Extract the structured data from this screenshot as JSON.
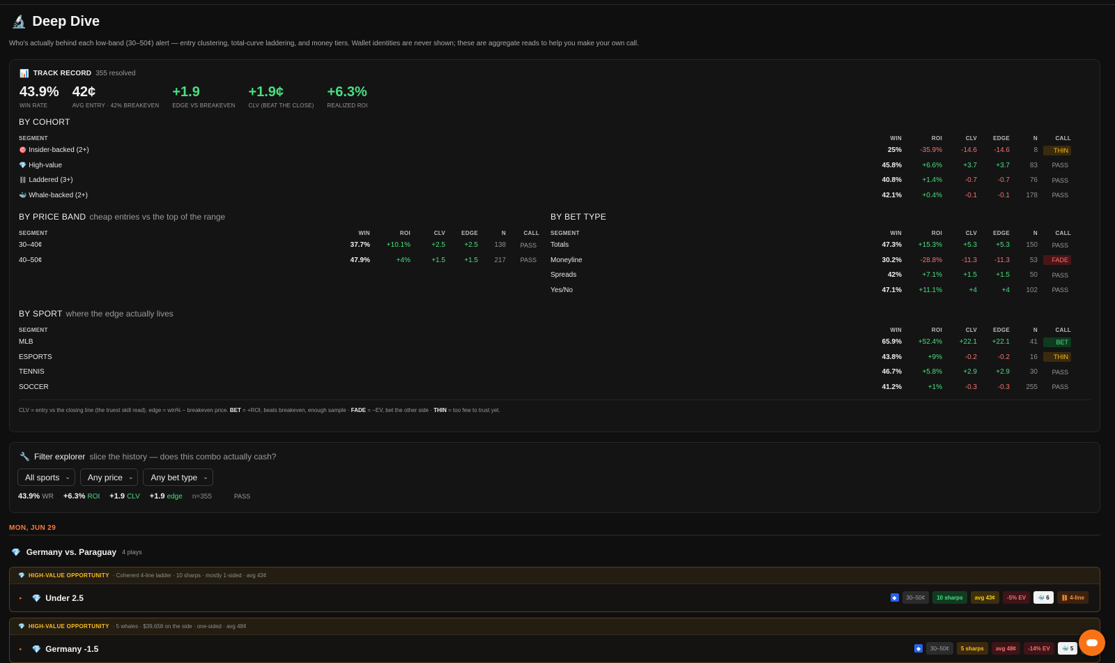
{
  "header": {
    "icon": "🔬",
    "title": "Deep Dive",
    "subtitle": "Who's actually behind each low-band (30–50¢) alert — entry clustering, total-curve laddering, and money tiers. Wallet identities are never shown; these are aggregate reads to help you make your own call."
  },
  "track": {
    "icon": "📊",
    "title": "TRACK RECORD",
    "resolved": "355 resolved",
    "stats": [
      {
        "value": "43.9%",
        "label": "WIN RATE",
        "green": false
      },
      {
        "value": "42¢",
        "label": "AVG ENTRY · 42% BREAKEVEN",
        "green": false
      },
      {
        "value": "+1.9",
        "label": "EDGE VS BREAKEVEN",
        "green": true
      },
      {
        "value": "+1.9¢",
        "label": "CLV (BEAT THE CLOSE)",
        "green": true
      },
      {
        "value": "+6.3%",
        "label": "REALIZED ROI",
        "green": true
      }
    ]
  },
  "cols": {
    "segment": "SEGMENT",
    "win": "WIN",
    "roi": "ROI",
    "clv": "CLV",
    "edge": "EDGE",
    "n": "N",
    "call": "CALL"
  },
  "cohort": {
    "title": "BY COHORT",
    "rows": [
      {
        "icon": "🎯",
        "name": "Insider-backed (2+)",
        "win": "25%",
        "roi": "-35.9%",
        "clv": "-14.6",
        "edge": "-14.6",
        "n": "8",
        "call": "THIN",
        "cls": "thin"
      },
      {
        "icon": "💎",
        "name": "High-value",
        "win": "45.8%",
        "roi": "+6.6%",
        "clv": "+3.7",
        "edge": "+3.7",
        "n": "83",
        "call": "PASS",
        "cls": ""
      },
      {
        "icon": "⛓",
        "name": "Laddered (3+)",
        "win": "40.8%",
        "roi": "+1.4%",
        "clv": "-0.7",
        "edge": "-0.7",
        "n": "76",
        "call": "PASS",
        "cls": ""
      },
      {
        "icon": "🐳",
        "name": "Whale-backed (2+)",
        "win": "42.1%",
        "roi": "+0.4%",
        "clv": "-0.1",
        "edge": "-0.1",
        "n": "178",
        "call": "PASS",
        "cls": ""
      }
    ]
  },
  "price_band": {
    "title": "BY PRICE BAND",
    "sub": "cheap entries vs the top of the range",
    "rows": [
      {
        "name": "30–40¢",
        "win": "37.7%",
        "roi": "+10.1%",
        "clv": "+2.5",
        "edge": "+2.5",
        "n": "138",
        "call": "PASS",
        "cls": ""
      },
      {
        "name": "40–50¢",
        "win": "47.9%",
        "roi": "+4%",
        "clv": "+1.5",
        "edge": "+1.5",
        "n": "217",
        "call": "PASS",
        "cls": ""
      }
    ]
  },
  "bet_type": {
    "title": "BY BET TYPE",
    "rows": [
      {
        "name": "Totals",
        "win": "47.3%",
        "roi": "+15.3%",
        "clv": "+5.3",
        "edge": "+5.3",
        "n": "150",
        "call": "PASS",
        "cls": ""
      },
      {
        "name": "Moneyline",
        "win": "30.2%",
        "roi": "-28.8%",
        "clv": "-11.3",
        "edge": "-11.3",
        "n": "53",
        "call": "FADE",
        "cls": "fade"
      },
      {
        "name": "Spreads",
        "win": "42%",
        "roi": "+7.1%",
        "clv": "+1.5",
        "edge": "+1.5",
        "n": "50",
        "call": "PASS",
        "cls": ""
      },
      {
        "name": "Yes/No",
        "win": "47.1%",
        "roi": "+11.1%",
        "clv": "+4",
        "edge": "+4",
        "n": "102",
        "call": "PASS",
        "cls": ""
      }
    ]
  },
  "sport": {
    "title": "BY SPORT",
    "sub": "where the edge actually lives",
    "rows": [
      {
        "name": "MLB",
        "win": "65.9%",
        "roi": "+52.4%",
        "clv": "+22.1",
        "edge": "+22.1",
        "n": "41",
        "call": "BET",
        "cls": "bet"
      },
      {
        "name": "ESPORTS",
        "win": "43.8%",
        "roi": "+9%",
        "clv": "-0.2",
        "edge": "-0.2",
        "n": "16",
        "call": "THIN",
        "cls": "thin"
      },
      {
        "name": "TENNIS",
        "win": "46.7%",
        "roi": "+5.8%",
        "clv": "+2.9",
        "edge": "+2.9",
        "n": "30",
        "call": "PASS",
        "cls": ""
      },
      {
        "name": "SOCCER",
        "win": "41.2%",
        "roi": "+1%",
        "clv": "-0.3",
        "edge": "-0.3",
        "n": "255",
        "call": "PASS",
        "cls": ""
      }
    ]
  },
  "legend": {
    "p1": "CLV = entry vs the closing line (the truest skill read). edge = win% − breakeven price. ",
    "bet": "BET",
    "p2": " = +ROI, beats breakeven, enough sample · ",
    "fade": "FADE",
    "p3": " = −EV, bet the other side · ",
    "thin": "THIN",
    "p4": " = too few to trust yet."
  },
  "filter": {
    "icon": "🔧",
    "title": "Filter explorer",
    "sub": "slice the history — does this combo actually cash?",
    "selects": [
      "All sports",
      "Any price",
      "Any bet type"
    ],
    "wr": "43.9%",
    "wr_label": "WR",
    "roi": "+6.3%",
    "roi_label": "ROI",
    "clv": "+1.9",
    "clv_label": "CLV",
    "edge": "+1.9",
    "edge_label": "edge",
    "n": "n=355",
    "call": "PASS"
  },
  "feed": {
    "date": "MON, JUN 29",
    "match": {
      "name": "Germany vs. Paraguay",
      "plays": "4 plays"
    },
    "opps": [
      {
        "tag": "HIGH-VALUE OPPORTUNITY",
        "desc": "· Coherent 4-line ladder · 10 sharps · mostly 1-sided · avg 43¢",
        "pick": "Under 2.5",
        "badges": [
          "30–50¢",
          "10 sharps",
          "avg 43¢",
          "-5% EV",
          "6",
          "4-line"
        ]
      },
      {
        "tag": "HIGH-VALUE OPPORTUNITY",
        "desc": "· 5 whales · $39,658 on the side · one-sided · avg 48¢",
        "pick": "Germany -1.5",
        "badges": [
          "30–50¢",
          "5 sharps",
          "avg 48¢",
          "-14% EV",
          "5",
          "1-sid"
        ]
      }
    ]
  }
}
